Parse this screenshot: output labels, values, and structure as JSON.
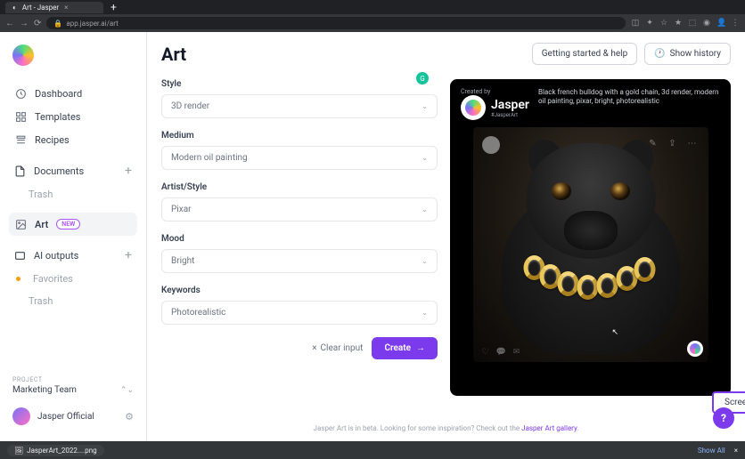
{
  "browser": {
    "tab_title": "Art - Jasper",
    "url": "app.jasper.ai/art",
    "download_file": "JasperArt_2022....png",
    "show_all": "Show All"
  },
  "sidebar": {
    "items": {
      "dashboard": "Dashboard",
      "templates": "Templates",
      "recipes": "Recipes",
      "documents": "Documents",
      "trash1": "Trash",
      "art": "Art",
      "art_badge": "NEW",
      "ai_outputs": "AI outputs",
      "favorites": "Favorites",
      "trash2": "Trash"
    },
    "project_label": "PROJECT",
    "project_name": "Marketing Team",
    "user_name": "Jasper Official"
  },
  "header": {
    "title": "Art",
    "getting_started": "Getting started & help",
    "show_history": "Show history"
  },
  "form": {
    "style": {
      "label": "Style",
      "value": "3D render"
    },
    "medium": {
      "label": "Medium",
      "value": "Modern oil painting"
    },
    "artist": {
      "label": "Artist/Style",
      "value": "Pixar"
    },
    "mood": {
      "label": "Mood",
      "value": "Bright"
    },
    "keywords": {
      "label": "Keywords",
      "value": "Photorealistic"
    },
    "clear": "Clear input",
    "create": "Create"
  },
  "preview": {
    "created_by": "Created by",
    "name": "Jasper",
    "hashtag": "#JasperArt",
    "description": "Black french bulldog with a gold chain, 3d render, modern oil painting, pixar, bright, photorealistic"
  },
  "screenshot_btn": "Screenshot",
  "beta": {
    "prefix": "Jasper Art is in beta. Looking for some inspiration? Check out the ",
    "link": "Jasper Art gallery"
  }
}
